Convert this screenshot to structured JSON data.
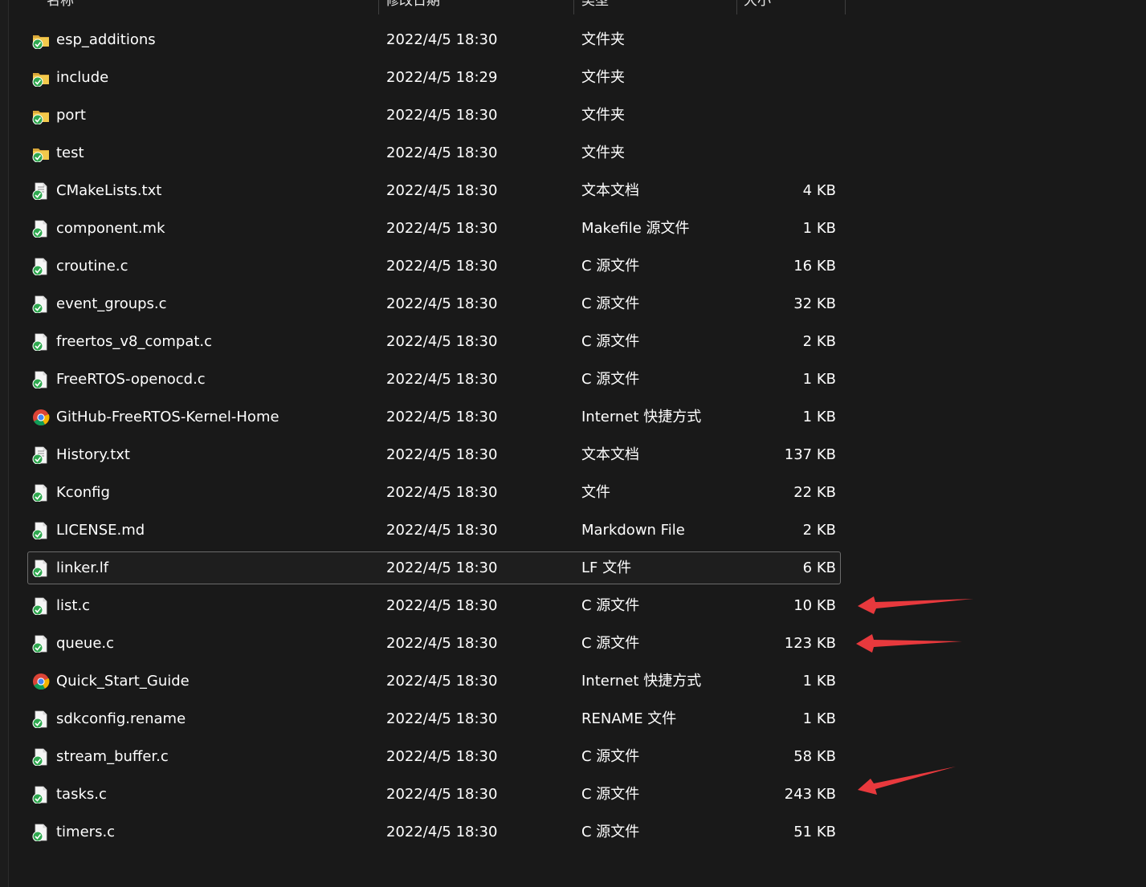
{
  "header": {
    "name": "名称",
    "date": "修改日期",
    "type": "类型",
    "size": "大小"
  },
  "rows": [
    {
      "name": "esp_additions",
      "date": "2022/4/5 18:30",
      "type": "文件夹",
      "size": "",
      "icon": "folder-icon"
    },
    {
      "name": "include",
      "date": "2022/4/5 18:29",
      "type": "文件夹",
      "size": "",
      "icon": "folder-icon"
    },
    {
      "name": "port",
      "date": "2022/4/5 18:30",
      "type": "文件夹",
      "size": "",
      "icon": "folder-icon"
    },
    {
      "name": "test",
      "date": "2022/4/5 18:30",
      "type": "文件夹",
      "size": "",
      "icon": "folder-icon"
    },
    {
      "name": "CMakeLists.txt",
      "date": "2022/4/5 18:30",
      "type": "文本文档",
      "size": "4 KB",
      "icon": "text-file-icon"
    },
    {
      "name": "component.mk",
      "date": "2022/4/5 18:30",
      "type": "Makefile 源文件",
      "size": "1 KB",
      "icon": "file-icon"
    },
    {
      "name": "croutine.c",
      "date": "2022/4/5 18:30",
      "type": "C 源文件",
      "size": "16 KB",
      "icon": "file-icon"
    },
    {
      "name": "event_groups.c",
      "date": "2022/4/5 18:30",
      "type": "C 源文件",
      "size": "32 KB",
      "icon": "file-icon"
    },
    {
      "name": "freertos_v8_compat.c",
      "date": "2022/4/5 18:30",
      "type": "C 源文件",
      "size": "2 KB",
      "icon": "file-icon"
    },
    {
      "name": "FreeRTOS-openocd.c",
      "date": "2022/4/5 18:30",
      "type": "C 源文件",
      "size": "1 KB",
      "icon": "file-icon"
    },
    {
      "name": "GitHub-FreeRTOS-Kernel-Home",
      "date": "2022/4/5 18:30",
      "type": "Internet 快捷方式",
      "size": "1 KB",
      "icon": "chrome-icon"
    },
    {
      "name": "History.txt",
      "date": "2022/4/5 18:30",
      "type": "文本文档",
      "size": "137 KB",
      "icon": "text-file-icon"
    },
    {
      "name": "Kconfig",
      "date": "2022/4/5 18:30",
      "type": "文件",
      "size": "22 KB",
      "icon": "file-icon"
    },
    {
      "name": "LICENSE.md",
      "date": "2022/4/5 18:30",
      "type": "Markdown File",
      "size": "2 KB",
      "icon": "file-icon"
    },
    {
      "name": "linker.lf",
      "date": "2022/4/5 18:30",
      "type": "LF 文件",
      "size": "6 KB",
      "icon": "file-icon",
      "selected": true
    },
    {
      "name": "list.c",
      "date": "2022/4/5 18:30",
      "type": "C 源文件",
      "size": "10 KB",
      "icon": "file-icon"
    },
    {
      "name": "queue.c",
      "date": "2022/4/5 18:30",
      "type": "C 源文件",
      "size": "123 KB",
      "icon": "file-icon"
    },
    {
      "name": "Quick_Start_Guide",
      "date": "2022/4/5 18:30",
      "type": "Internet 快捷方式",
      "size": "1 KB",
      "icon": "chrome-icon"
    },
    {
      "name": "sdkconfig.rename",
      "date": "2022/4/5 18:30",
      "type": "RENAME 文件",
      "size": "1 KB",
      "icon": "file-icon"
    },
    {
      "name": "stream_buffer.c",
      "date": "2022/4/5 18:30",
      "type": "C 源文件",
      "size": "58 KB",
      "icon": "file-icon"
    },
    {
      "name": "tasks.c",
      "date": "2022/4/5 18:30",
      "type": "C 源文件",
      "size": "243 KB",
      "icon": "file-icon"
    },
    {
      "name": "timers.c",
      "date": "2022/4/5 18:30",
      "type": "C 源文件",
      "size": "51 KB",
      "icon": "file-icon"
    }
  ],
  "colors": {
    "background": "#191919",
    "text": "#ffffff",
    "arrow": "#e8393d",
    "folder": "#f2c14b",
    "check": "#2fa84f"
  }
}
